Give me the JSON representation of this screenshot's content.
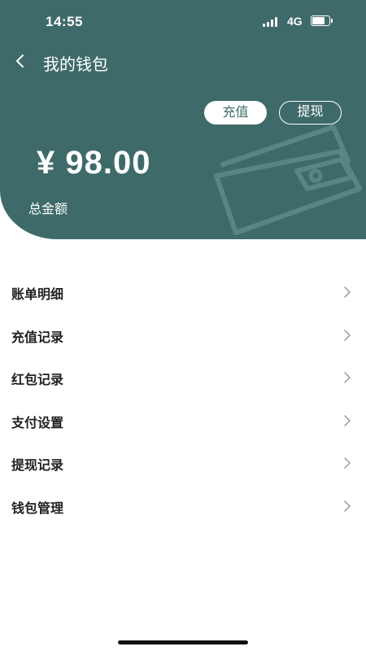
{
  "status_bar": {
    "time": "14:55",
    "network": "4G"
  },
  "header": {
    "title": "我的钱包",
    "recharge_label": "充值",
    "withdraw_label": "提现",
    "balance": "¥ 98.00",
    "balance_label": "总金额"
  },
  "menu": [
    {
      "label": "账单明细"
    },
    {
      "label": "充值记录"
    },
    {
      "label": "红包记录"
    },
    {
      "label": "支付设置"
    },
    {
      "label": "提现记录"
    },
    {
      "label": "钱包管理"
    }
  ],
  "colors": {
    "header_bg": "#3e6b69",
    "page_bg": "#ffffff",
    "text": "#222222"
  },
  "icons": {
    "back": "chevron-left-icon",
    "row": "chevron-right-icon",
    "wallet": "wallet-icon"
  }
}
